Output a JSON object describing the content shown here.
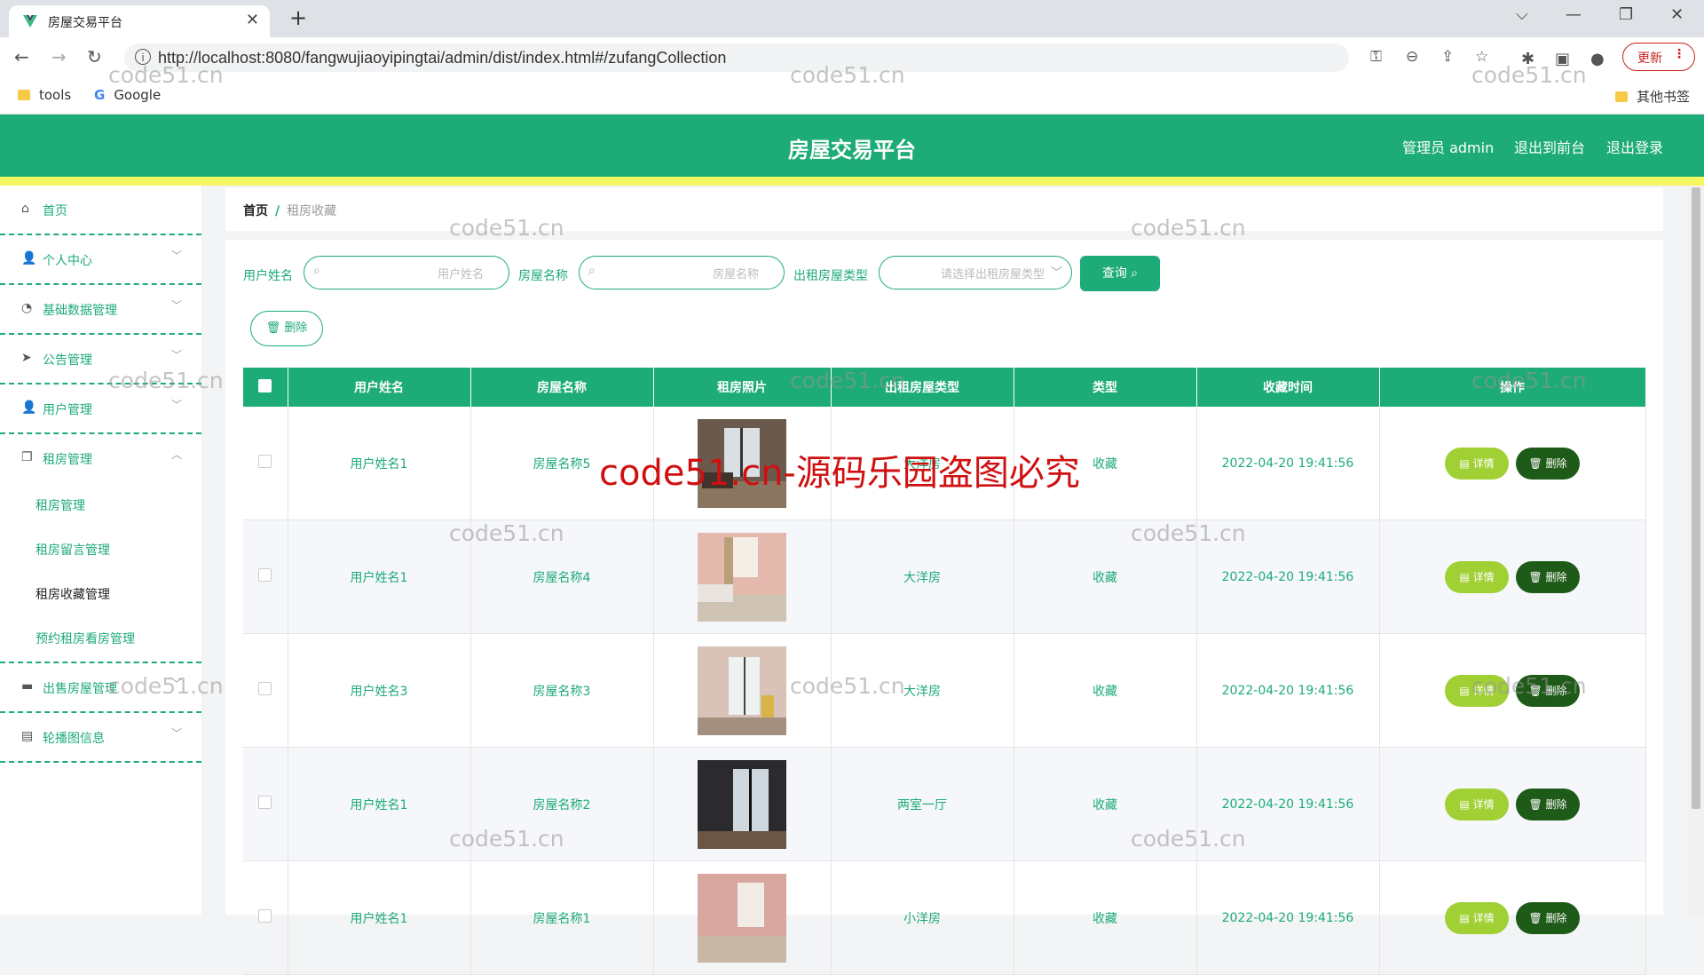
{
  "browser": {
    "tab_title": "房屋交易平台",
    "url": "http://localhost:8080/fangwujiaoyipingtai/admin/dist/index.html#/zufangCollection",
    "update_label": "更新",
    "bookmarks": [
      "tools",
      "Google"
    ],
    "other_bookmarks": "其他书签"
  },
  "header": {
    "title": "房屋交易平台",
    "admin": "管理员 admin",
    "to_front": "退出到前台",
    "logout": "退出登录"
  },
  "sidebar": {
    "items": [
      {
        "label": "首页",
        "icon": "home-icon"
      },
      {
        "label": "个人中心",
        "icon": "user-icon"
      },
      {
        "label": "基础数据管理",
        "icon": "gauge-icon"
      },
      {
        "label": "公告管理",
        "icon": "send-icon"
      },
      {
        "label": "用户管理",
        "icon": "user-icon"
      },
      {
        "label": "租房管理",
        "icon": "copy-icon"
      },
      {
        "label": "出售房屋管理",
        "icon": "monitor-icon"
      },
      {
        "label": "轮播图信息",
        "icon": "doc-icon"
      }
    ],
    "sub_items": [
      "租房管理",
      "租房留言管理",
      "租房收藏管理",
      "预约租房看房管理"
    ]
  },
  "breadcrumb": {
    "home": "首页",
    "sep": "/",
    "current": "租房收藏"
  },
  "filters": {
    "user_label": "用户姓名",
    "user_placeholder": "用户姓名",
    "house_label": "房屋名称",
    "house_placeholder": "房屋名称",
    "type_label": "出租房屋类型",
    "type_placeholder": "请选择出租房屋类型",
    "query_label": "查询",
    "delete_label": "删除"
  },
  "table": {
    "headers": [
      "用户姓名",
      "房屋名称",
      "租房照片",
      "出租房屋类型",
      "类型",
      "收藏时间",
      "操作"
    ],
    "detail_label": "详情",
    "delete_label": "删除",
    "rows": [
      {
        "user": "用户姓名1",
        "house": "房屋名称5",
        "rent_type": "大洋房",
        "type": "收藏",
        "time": "2022-04-20 19:41:56"
      },
      {
        "user": "用户姓名1",
        "house": "房屋名称4",
        "rent_type": "大洋房",
        "type": "收藏",
        "time": "2022-04-20 19:41:56"
      },
      {
        "user": "用户姓名3",
        "house": "房屋名称3",
        "rent_type": "大洋房",
        "type": "收藏",
        "time": "2022-04-20 19:41:56"
      },
      {
        "user": "用户姓名1",
        "house": "房屋名称2",
        "rent_type": "两室一厅",
        "type": "收藏",
        "time": "2022-04-20 19:41:56"
      },
      {
        "user": "用户姓名1",
        "house": "房屋名称1",
        "rent_type": "小洋房",
        "type": "收藏",
        "time": "2022-04-20 19:41:56"
      }
    ]
  },
  "watermarks": {
    "small": "code51.cn",
    "big": "code51.cn-源码乐园盗图必究"
  },
  "colors": {
    "primary": "#1dab77",
    "accent": "#f7f762",
    "detail": "#a0d034",
    "delete": "#1e5a18"
  }
}
